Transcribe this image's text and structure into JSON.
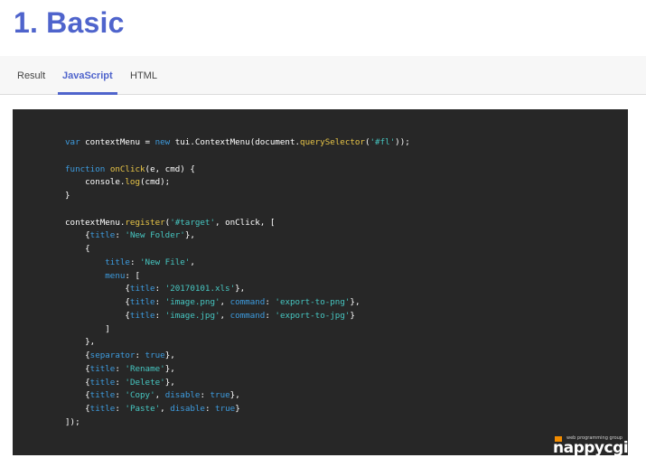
{
  "page": {
    "title": "1. Basic"
  },
  "tabs": [
    {
      "label": "Result",
      "active": false
    },
    {
      "label": "JavaScript",
      "active": true
    },
    {
      "label": "HTML",
      "active": false
    }
  ],
  "colors": {
    "accent": "#4f64cc",
    "code_background": "#272727",
    "keyword": "#3d9bde",
    "function": "#e8c547",
    "string": "#46c6c1"
  },
  "code": {
    "language": "JavaScript",
    "lines": [
      [
        [
          "kw",
          "var"
        ],
        [
          "pl",
          " contextMenu = "
        ],
        [
          "kw",
          "new"
        ],
        [
          "pl",
          " tui.ContextMenu(document."
        ],
        [
          "fn",
          "querySelector"
        ],
        [
          "pl",
          "("
        ],
        [
          "str",
          "'#fl'"
        ],
        [
          "pl",
          "));"
        ]
      ],
      [],
      [
        [
          "kw",
          "function"
        ],
        [
          "pl",
          " "
        ],
        [
          "fn",
          "onClick"
        ],
        [
          "pl",
          "(e, cmd) {"
        ]
      ],
      [
        [
          "pl",
          "    console."
        ],
        [
          "fn",
          "log"
        ],
        [
          "pl",
          "(cmd);"
        ]
      ],
      [
        [
          "pl",
          "}"
        ]
      ],
      [],
      [
        [
          "pl",
          "contextMenu."
        ],
        [
          "fn",
          "register"
        ],
        [
          "pl",
          "("
        ],
        [
          "str",
          "'#target'"
        ],
        [
          "pl",
          ", onClick, ["
        ]
      ],
      [
        [
          "pl",
          "    {"
        ],
        [
          "key",
          "title"
        ],
        [
          "pl",
          ": "
        ],
        [
          "str",
          "'New Folder'"
        ],
        [
          "pl",
          "},"
        ]
      ],
      [
        [
          "pl",
          "    {"
        ]
      ],
      [
        [
          "pl",
          "        "
        ],
        [
          "key",
          "title"
        ],
        [
          "pl",
          ": "
        ],
        [
          "str",
          "'New File'"
        ],
        [
          "pl",
          ","
        ]
      ],
      [
        [
          "pl",
          "        "
        ],
        [
          "key",
          "menu"
        ],
        [
          "pl",
          ": ["
        ]
      ],
      [
        [
          "pl",
          "            {"
        ],
        [
          "key",
          "title"
        ],
        [
          "pl",
          ": "
        ],
        [
          "str",
          "'20170101.xls'"
        ],
        [
          "pl",
          "},"
        ]
      ],
      [
        [
          "pl",
          "            {"
        ],
        [
          "key",
          "title"
        ],
        [
          "pl",
          ": "
        ],
        [
          "str",
          "'image.png'"
        ],
        [
          "pl",
          ", "
        ],
        [
          "key",
          "command"
        ],
        [
          "pl",
          ": "
        ],
        [
          "str",
          "'export-to-png'"
        ],
        [
          "pl",
          "},"
        ]
      ],
      [
        [
          "pl",
          "            {"
        ],
        [
          "key",
          "title"
        ],
        [
          "pl",
          ": "
        ],
        [
          "str",
          "'image.jpg'"
        ],
        [
          "pl",
          ", "
        ],
        [
          "key",
          "command"
        ],
        [
          "pl",
          ": "
        ],
        [
          "str",
          "'export-to-jpg'"
        ],
        [
          "pl",
          "}"
        ]
      ],
      [
        [
          "pl",
          "        ]"
        ]
      ],
      [
        [
          "pl",
          "    },"
        ]
      ],
      [
        [
          "pl",
          "    {"
        ],
        [
          "key",
          "separator"
        ],
        [
          "pl",
          ": "
        ],
        [
          "lit",
          "true"
        ],
        [
          "pl",
          "},"
        ]
      ],
      [
        [
          "pl",
          "    {"
        ],
        [
          "key",
          "title"
        ],
        [
          "pl",
          ": "
        ],
        [
          "str",
          "'Rename'"
        ],
        [
          "pl",
          "},"
        ]
      ],
      [
        [
          "pl",
          "    {"
        ],
        [
          "key",
          "title"
        ],
        [
          "pl",
          ": "
        ],
        [
          "str",
          "'Delete'"
        ],
        [
          "pl",
          "},"
        ]
      ],
      [
        [
          "pl",
          "    {"
        ],
        [
          "key",
          "title"
        ],
        [
          "pl",
          ": "
        ],
        [
          "str",
          "'Copy'"
        ],
        [
          "pl",
          ", "
        ],
        [
          "key",
          "disable"
        ],
        [
          "pl",
          ": "
        ],
        [
          "lit",
          "true"
        ],
        [
          "pl",
          "},"
        ]
      ],
      [
        [
          "pl",
          "    {"
        ],
        [
          "key",
          "title"
        ],
        [
          "pl",
          ": "
        ],
        [
          "str",
          "'Paste'"
        ],
        [
          "pl",
          ", "
        ],
        [
          "key",
          "disable"
        ],
        [
          "pl",
          ": "
        ],
        [
          "lit",
          "true"
        ],
        [
          "pl",
          "}"
        ]
      ],
      [
        [
          "pl",
          "]);"
        ]
      ]
    ]
  },
  "watermark": {
    "tagline": "web programming group",
    "logo_text": "nappycgi"
  }
}
